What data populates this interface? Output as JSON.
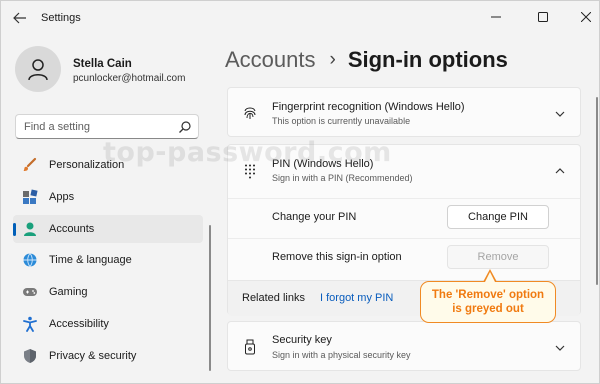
{
  "window": {
    "app_title": "Settings",
    "controls": {
      "minimize": "—",
      "maximize": "☐",
      "close": "✕"
    }
  },
  "profile": {
    "name": "Stella Cain",
    "email": "pcunlocker@hotmail.com"
  },
  "search": {
    "placeholder": "Find a setting"
  },
  "sidebar": {
    "items": [
      {
        "label": "Personalization",
        "icon": "brush-icon",
        "active": false
      },
      {
        "label": "Apps",
        "icon": "apps-icon",
        "active": false
      },
      {
        "label": "Accounts",
        "icon": "person-icon",
        "active": true
      },
      {
        "label": "Time & language",
        "icon": "globe-clock-icon",
        "active": false
      },
      {
        "label": "Gaming",
        "icon": "gamepad-icon",
        "active": false
      },
      {
        "label": "Accessibility",
        "icon": "accessibility-icon",
        "active": false
      },
      {
        "label": "Privacy & security",
        "icon": "shield-icon",
        "active": false
      }
    ]
  },
  "header": {
    "parent": "Accounts",
    "separator": "›",
    "current": "Sign-in options"
  },
  "cards": {
    "fingerprint": {
      "title": "Fingerprint recognition (Windows Hello)",
      "subtitle": "This option is currently unavailable"
    },
    "pin": {
      "title": "PIN (Windows Hello)",
      "subtitle": "Sign in with a PIN (Recommended)",
      "change_label": "Change your PIN",
      "change_button": "Change PIN",
      "remove_label": "Remove this sign-in option",
      "remove_button": "Remove",
      "related_label": "Related links",
      "related_link": "I forgot my PIN"
    },
    "security_key": {
      "title": "Security key",
      "subtitle": "Sign in with a physical security key"
    }
  },
  "annotation": {
    "line1": "The 'Remove' option",
    "line2": "is greyed out"
  },
  "watermark": "top-password.com",
  "colors": {
    "accent": "#005fb8",
    "link": "#0a5dbd",
    "callout_border": "#f08a24",
    "callout_text": "#f07a10"
  }
}
